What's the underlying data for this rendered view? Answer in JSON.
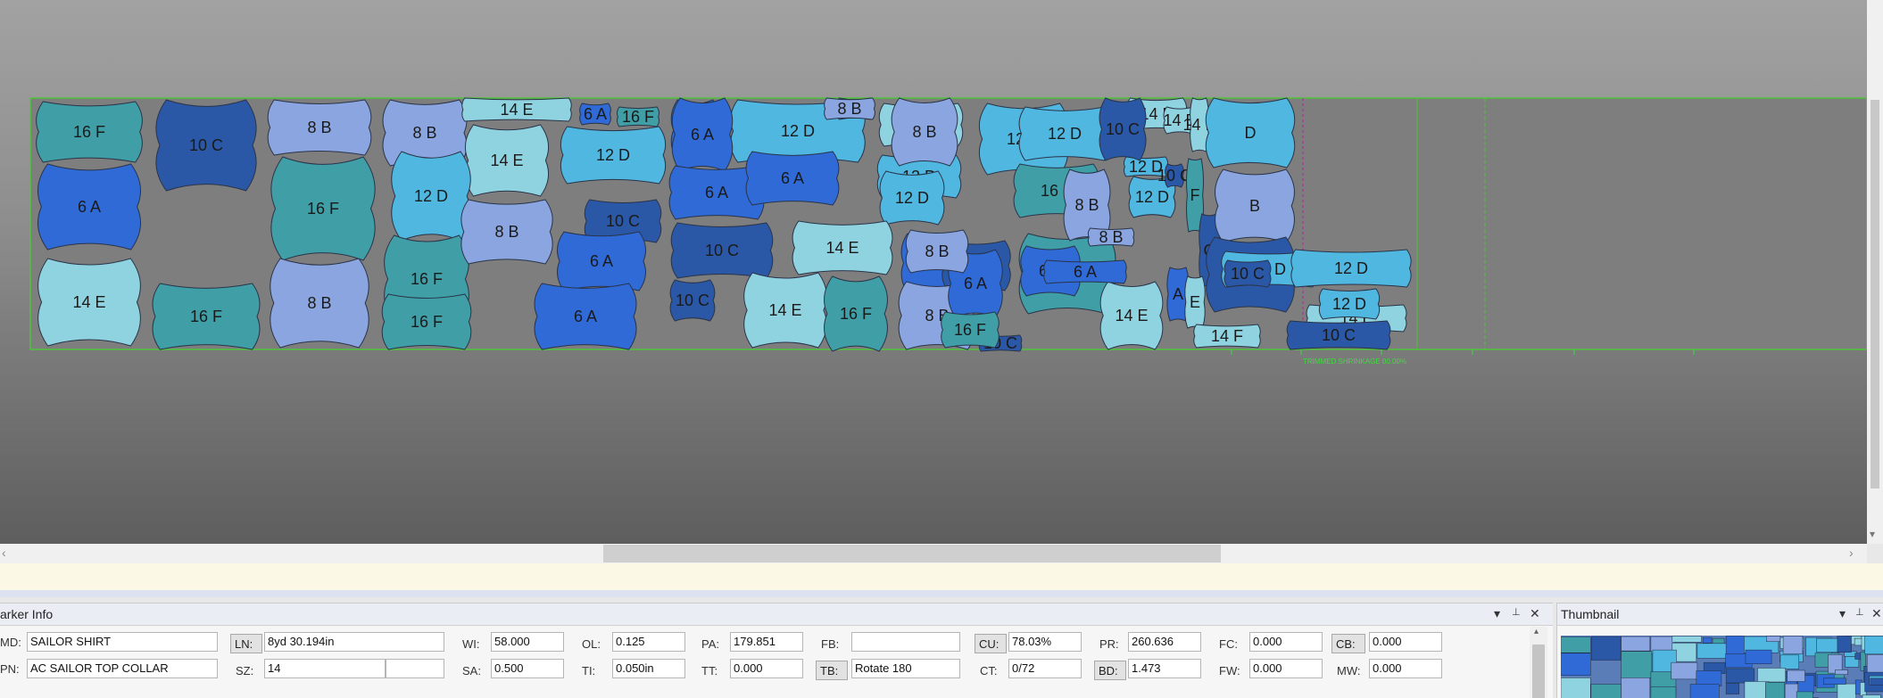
{
  "workspace": {
    "fabric_border_color": "#4fc43a",
    "ruler_text": "TRIMMED SHRINKAGE 00.00%",
    "pieces": [
      {
        "label": "16 F",
        "color": "#3f9ea6"
      },
      {
        "label": "10 C",
        "color": "#2b58a6"
      },
      {
        "label": "8 B",
        "color": "#8aa5df"
      },
      {
        "label": "8 B",
        "color": "#8aa5df"
      },
      {
        "label": "14 E",
        "color": "#8ed3df"
      },
      {
        "label": "6 A",
        "color": "#2f6ad7"
      },
      {
        "label": "16 F",
        "color": "#3f9ea6"
      },
      {
        "label": "6 A",
        "color": "#2f6ad7"
      },
      {
        "label": "12 D",
        "color": "#4fb7e0"
      },
      {
        "label": "16 F",
        "color": "#3f9ea6"
      },
      {
        "label": "12 D",
        "color": "#4fb7e0"
      },
      {
        "label": "14 E",
        "color": "#8ed3df"
      },
      {
        "label": "14 E",
        "color": "#8ed3df"
      },
      {
        "label": "16 F",
        "color": "#3f9ea6"
      },
      {
        "label": "8 B",
        "color": "#8aa5df"
      },
      {
        "label": "12 D",
        "color": "#4fb7e0"
      },
      {
        "label": "16 F",
        "color": "#3f9ea6"
      },
      {
        "label": "12 D",
        "color": "#4fb7e0"
      },
      {
        "label": "16 F",
        "color": "#3f9ea6"
      },
      {
        "label": "8 B",
        "color": "#8aa5df"
      },
      {
        "label": "10 C",
        "color": "#2b58a6"
      },
      {
        "label": "6 A",
        "color": "#2f6ad7"
      },
      {
        "label": "16 F",
        "color": "#3f9ea6"
      },
      {
        "label": "6 A",
        "color": "#2f6ad7"
      },
      {
        "label": "6 A",
        "color": "#2f6ad7"
      },
      {
        "label": "6 A",
        "color": "#2f6ad7"
      },
      {
        "label": "10 C",
        "color": "#2b58a6"
      },
      {
        "label": "12 D",
        "color": "#4fb7e0"
      },
      {
        "label": "8 B",
        "color": "#8aa5df"
      },
      {
        "label": "14 E",
        "color": "#8ed3df"
      },
      {
        "label": "6 A",
        "color": "#2f6ad7"
      },
      {
        "label": "10 C",
        "color": "#2b58a6"
      },
      {
        "label": "14 E",
        "color": "#8ed3df"
      },
      {
        "label": "6 A",
        "color": "#2f6ad7"
      },
      {
        "label": "14 E",
        "color": "#8ed3df"
      },
      {
        "label": "16 F",
        "color": "#3f9ea6"
      },
      {
        "label": "8 B",
        "color": "#8aa5df"
      },
      {
        "label": "12 D",
        "color": "#4fb7e0"
      },
      {
        "label": "6 A",
        "color": "#2f6ad7"
      },
      {
        "label": "10 C",
        "color": "#2b58a6"
      },
      {
        "label": "8 B",
        "color": "#8aa5df"
      },
      {
        "label": "16 F",
        "color": "#3f9ea6"
      },
      {
        "label": "10 C",
        "color": "#2b58a6"
      },
      {
        "label": "12 D",
        "color": "#4fb7e0"
      },
      {
        "label": "12 D",
        "color": "#4fb7e0"
      },
      {
        "label": "14 E",
        "color": "#8ed3df"
      },
      {
        "label": "16 F",
        "color": "#3f9ea6"
      },
      {
        "label": "6 A",
        "color": "#2f6ad7"
      },
      {
        "label": "8 B",
        "color": "#8aa5df"
      },
      {
        "label": "6 A",
        "color": "#2f6ad7"
      },
      {
        "label": "10 C",
        "color": "#2b58a6"
      },
      {
        "label": "12 D",
        "color": "#4fb7e0"
      },
      {
        "label": "8 B",
        "color": "#8aa5df"
      },
      {
        "label": "14 E",
        "color": "#8ed3df"
      },
      {
        "label": "16 F",
        "color": "#3f9ea6"
      },
      {
        "label": "10 C",
        "color": "#2b58a6"
      },
      {
        "label": "6 A",
        "color": "#2f6ad7"
      },
      {
        "label": "8 B",
        "color": "#8aa5df"
      },
      {
        "label": "14 E",
        "color": "#8ed3df"
      },
      {
        "label": "10 C",
        "color": "#2b58a6"
      },
      {
        "label": "14 E",
        "color": "#8ed3df"
      },
      {
        "label": "F",
        "color": "#3f9ea6"
      },
      {
        "label": "C",
        "color": "#2b58a6"
      },
      {
        "label": "A",
        "color": "#2f6ad7"
      },
      {
        "label": "E",
        "color": "#8ed3df"
      },
      {
        "label": "D",
        "color": "#4fb7e0"
      },
      {
        "label": "B",
        "color": "#8aa5df"
      },
      {
        "label": "10 C",
        "color": "#2b58a6"
      },
      {
        "label": "12 D",
        "color": "#4fb7e0"
      },
      {
        "label": "10 C",
        "color": "#2b58a6"
      },
      {
        "label": "12 D",
        "color": "#4fb7e0"
      },
      {
        "label": "14 E",
        "color": "#8ed3df"
      },
      {
        "label": "12 D",
        "color": "#4fb7e0"
      },
      {
        "label": "10 C",
        "color": "#2b58a6"
      },
      {
        "label": "14 F",
        "color": "#8ed3df"
      },
      {
        "label": "16 F",
        "color": "#3f9ea6"
      }
    ]
  },
  "marker_info": {
    "title": "arker Info",
    "fields": {
      "md_label": "MD:",
      "md_value": "SAILOR SHIRT",
      "pn_label": "PN:",
      "pn_value": "AC SAILOR TOP COLLAR",
      "ln_label": "LN:",
      "ln_value": "8yd 30.194in",
      "sz_label": "SZ:",
      "sz_value": "14",
      "wi_label": "WI:",
      "wi_value": "58.000",
      "sa_label": "SA:",
      "sa_value": "0.500",
      "ol_label": "OL:",
      "ol_value": "0.125",
      "ti_label": "TI:",
      "ti_value": "0.050in",
      "pa_label": "PA:",
      "pa_value": "179.851",
      "tt_label": "TT:",
      "tt_value": "0.000",
      "fb_label": "FB:",
      "fb_value": "",
      "tb_label": "TB:",
      "tb_value": "Rotate 180",
      "cu_label": "CU:",
      "cu_value": "78.03%",
      "ct_label": "CT:",
      "ct_value": "0/72",
      "pr_label": "PR:",
      "pr_value": "260.636",
      "bd_label": "BD:",
      "bd_value": "1.473",
      "fc_label": "FC:",
      "fc_value": "0.000",
      "fw_label": "FW:",
      "fw_value": "0.000",
      "cb_label": "CB:",
      "cb_value": "0.000",
      "mw_label": "MW:",
      "mw_value": "0.000"
    }
  },
  "thumbnail": {
    "title": "Thumbnail"
  },
  "icons": {
    "dropdown": "▾",
    "pin": "📌",
    "close": "✕"
  }
}
